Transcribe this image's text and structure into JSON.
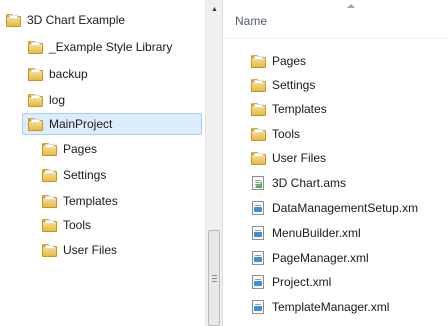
{
  "nav_tree": {
    "items": [
      {
        "label": "3D Chart Example",
        "icon": "folder-icon",
        "selected": false
      },
      {
        "label": "_Example Style Library",
        "icon": "folder-icon",
        "selected": false
      },
      {
        "label": "backup",
        "icon": "folder-icon",
        "selected": false
      },
      {
        "label": "log",
        "icon": "folder-icon",
        "selected": false
      },
      {
        "label": "MainProject",
        "icon": "folder-icon",
        "selected": true
      },
      {
        "label": "Pages",
        "icon": "folder-icon",
        "selected": false
      },
      {
        "label": "Settings",
        "icon": "folder-icon",
        "selected": false
      },
      {
        "label": "Templates",
        "icon": "folder-icon",
        "selected": false
      },
      {
        "label": "Tools",
        "icon": "folder-icon",
        "selected": false
      },
      {
        "label": "User Files",
        "icon": "folder-icon",
        "selected": false
      }
    ]
  },
  "file_list": {
    "header": "Name",
    "items": [
      {
        "label": "Pages",
        "icon": "folder-icon"
      },
      {
        "label": "Settings",
        "icon": "folder-icon"
      },
      {
        "label": "Templates",
        "icon": "folder-icon"
      },
      {
        "label": "Tools",
        "icon": "folder-icon"
      },
      {
        "label": "User Files",
        "icon": "folder-icon"
      },
      {
        "label": "3D Chart.ams",
        "icon": "ams-file-icon"
      },
      {
        "label": "DataManagementSetup.xm",
        "icon": "xml-file-icon"
      },
      {
        "label": "MenuBuilder.xml",
        "icon": "xml-file-icon"
      },
      {
        "label": "PageManager.xml",
        "icon": "xml-file-icon"
      },
      {
        "label": "Project.xml",
        "icon": "xml-file-icon"
      },
      {
        "label": "TemplateManager.xml",
        "icon": "xml-file-icon"
      }
    ]
  },
  "colors": {
    "selection": "#dcecfc",
    "selection_border": "#a8d0f5",
    "header_text": "#4c607a"
  }
}
